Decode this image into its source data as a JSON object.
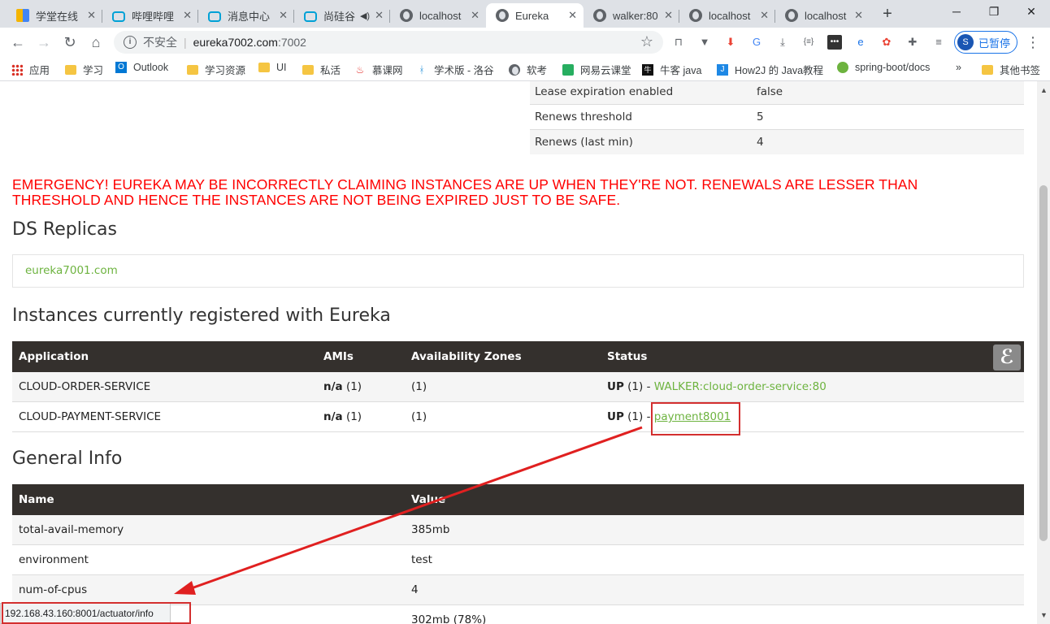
{
  "tabs": [
    {
      "label": "学堂在线",
      "icon": "xuetang-icon",
      "active": false
    },
    {
      "label": "哔哩哔哩",
      "icon": "bilibili-icon",
      "active": false
    },
    {
      "label": "消息中心",
      "icon": "bilibili-icon",
      "active": false
    },
    {
      "label": "尚硅谷",
      "icon": "bilibili-icon",
      "active": false
    },
    {
      "label": "localhost",
      "icon": "globe-icon",
      "active": false
    },
    {
      "label": "Eureka",
      "icon": "globe-icon",
      "active": true
    },
    {
      "label": "walker:80",
      "icon": "globe-icon",
      "active": false
    },
    {
      "label": "localhost",
      "icon": "globe-icon",
      "active": false
    },
    {
      "label": "localhost",
      "icon": "globe-icon",
      "active": false
    }
  ],
  "address": {
    "insecure_label": "不安全",
    "host": "eureka7002.com",
    "port": ":7002"
  },
  "profile": {
    "initial": "S",
    "label": "已暂停"
  },
  "bookmarks": [
    "应用",
    "学习",
    "Outlook",
    "学习资源",
    "UI",
    "私活",
    "慕课网",
    "学术版 - 洛谷",
    "软考",
    "网易云课堂",
    "牛客 java",
    "How2J 的 Java教程",
    "spring-boot/docs",
    "»",
    "其他书签"
  ],
  "lease": [
    {
      "key": "Lease expiration enabled",
      "value": "false"
    },
    {
      "key": "Renews threshold",
      "value": "5"
    },
    {
      "key": "Renews (last min)",
      "value": "4"
    }
  ],
  "emergency": "EMERGENCY! EUREKA MAY BE INCORRECTLY CLAIMING INSTANCES ARE UP WHEN THEY'RE NOT. RENEWALS ARE LESSER THAN THRESHOLD AND HENCE THE INSTANCES ARE NOT BEING EXPIRED JUST TO BE SAFE.",
  "replicas": {
    "title": "DS Replicas",
    "items": [
      "eureka7001.com"
    ]
  },
  "instances": {
    "title": "Instances currently registered with Eureka",
    "headers": [
      "Application",
      "AMIs",
      "Availability Zones",
      "Status"
    ],
    "rows": [
      {
        "app": "CLOUD-ORDER-SERVICE",
        "ami": "n/a",
        "ami_count": "(1)",
        "zones": "(1)",
        "status": "UP",
        "status_count": "(1) -",
        "link": "WALKER:cloud-order-service:80"
      },
      {
        "app": "CLOUD-PAYMENT-SERVICE",
        "ami": "n/a",
        "ami_count": "(1)",
        "zones": "(1)",
        "status": "UP",
        "status_count": "(1) -",
        "link": "payment8001"
      }
    ]
  },
  "general": {
    "title": "General Info",
    "headers": [
      "Name",
      "Value"
    ],
    "rows": [
      {
        "name": "total-avail-memory",
        "value": "385mb"
      },
      {
        "name": "environment",
        "value": "test"
      },
      {
        "name": "num-of-cpus",
        "value": "4"
      },
      {
        "name": "",
        "value": "302mb (78%)"
      }
    ]
  },
  "status_url": "192.168.43.160:8001/actuator/info",
  "colors": {
    "accent_green": "#6db33f",
    "header_dark": "#34302d",
    "emergency_red": "#ff0000",
    "annotation_red": "#d32f2f"
  }
}
